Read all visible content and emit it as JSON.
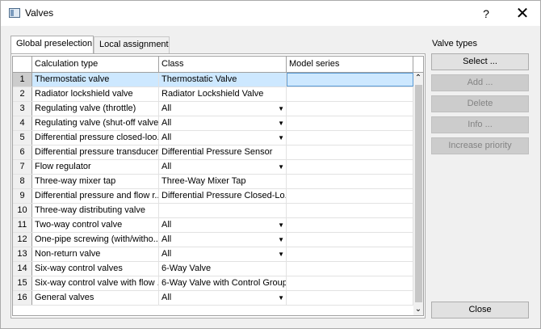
{
  "window": {
    "title": "Valves",
    "help": "?",
    "close": "✕"
  },
  "tabs": [
    {
      "label": "Global preselection"
    },
    {
      "label": "Local assignment"
    }
  ],
  "grid": {
    "headers": {
      "num": "",
      "calc": "Calculation type",
      "class": "Class",
      "model": "Model series"
    },
    "rows": [
      {
        "num": "1",
        "calc": "Thermostatic valve",
        "class": "Thermostatic Valve",
        "model": ""
      },
      {
        "num": "2",
        "calc": "Radiator lockshield valve",
        "class": "Radiator Lockshield Valve",
        "model": ""
      },
      {
        "num": "3",
        "calc": "Regulating valve (throttle)",
        "class": "All",
        "model": ""
      },
      {
        "num": "4",
        "calc": "Regulating valve (shut-off valve)",
        "class": "All",
        "model": ""
      },
      {
        "num": "5",
        "calc": "Differential pressure closed-loo...",
        "class": "All",
        "model": ""
      },
      {
        "num": "6",
        "calc": "Differential pressure transducer",
        "class": "Differential Pressure Sensor",
        "model": ""
      },
      {
        "num": "7",
        "calc": "Flow regulator",
        "class": "All",
        "model": ""
      },
      {
        "num": "8",
        "calc": "Three-way mixer tap",
        "class": "Three-Way Mixer Tap",
        "model": ""
      },
      {
        "num": "9",
        "calc": "Differential pressure and flow r...",
        "class": "Differential Pressure Closed-Lo...",
        "model": ""
      },
      {
        "num": "10",
        "calc": "Three-way distributing valve",
        "class": "",
        "model": ""
      },
      {
        "num": "11",
        "calc": "Two-way control valve",
        "class": "All",
        "model": ""
      },
      {
        "num": "12",
        "calc": "One-pipe screwing (with/witho...",
        "class": "All",
        "model": ""
      },
      {
        "num": "13",
        "calc": "Non-return valve",
        "class": "All",
        "model": ""
      },
      {
        "num": "14",
        "calc": "Six-way control valves",
        "class": "6-Way Valve",
        "model": ""
      },
      {
        "num": "15",
        "calc": "Six-way control valve with flow ...",
        "class": "6-Way Valve with Control Group",
        "model": ""
      },
      {
        "num": "16",
        "calc": "General valves",
        "class": "All",
        "model": ""
      }
    ],
    "scroll_up": "⌃",
    "scroll_down": "⌄"
  },
  "side": {
    "label": "Valve types",
    "select": "Select ...",
    "add": "Add ...",
    "delete": "Delete",
    "info": "Info ...",
    "increase": "Increase priority",
    "close": "Close"
  }
}
